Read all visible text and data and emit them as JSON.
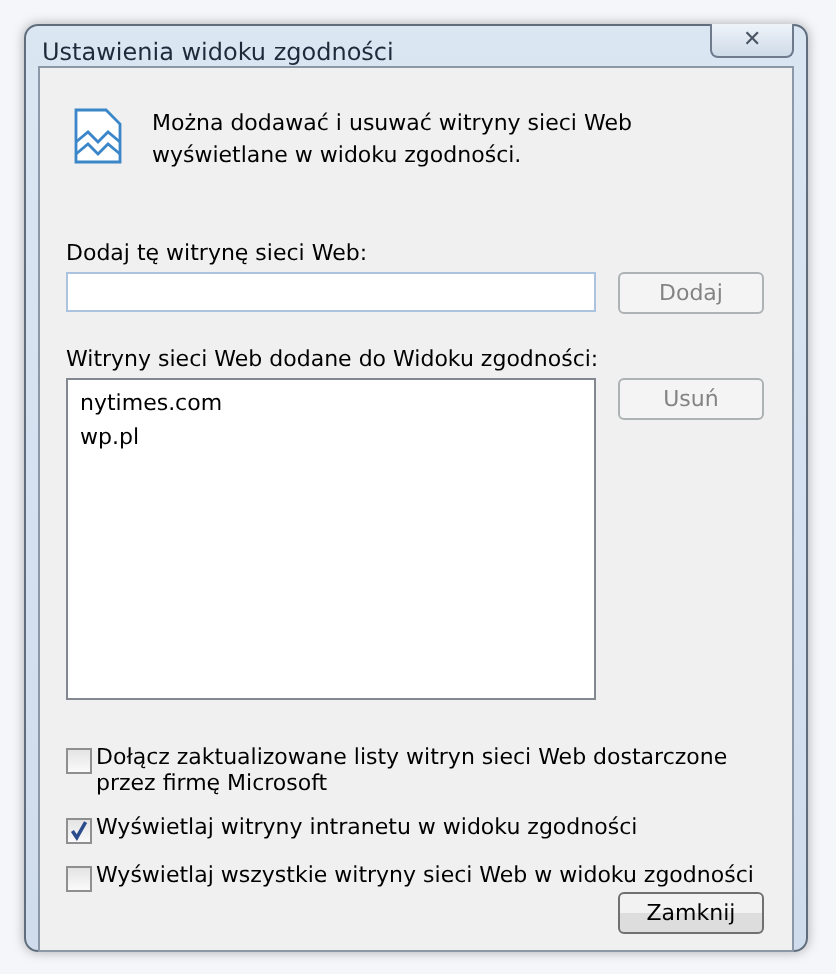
{
  "window": {
    "title": "Ustawienia widoku zgodności",
    "close": "✕"
  },
  "intro": "Można dodawać i usuwać witryny sieci Web wyświetlane w widoku zgodności.",
  "add_site": {
    "label": "Dodaj tę witrynę sieci Web:",
    "button": {
      "label": "Dodaj",
      "disabled": true
    }
  },
  "sites": {
    "label": "Witryny sieci Web dodane do Widoku zgodności:",
    "items": [
      {
        "text": "nytimes.com",
        "selected": false
      },
      {
        "text": "wp.pl",
        "selected": false
      }
    ],
    "button": {
      "label": "Usuń",
      "disabled": true
    }
  },
  "options": [
    {
      "label": "Dołącz zaktualizowane listy witryn sieci Web dostarczone przez firmę Microsoft",
      "checked": false
    },
    {
      "label": "Wyświetlaj witryny intranetu w widoku zgodności",
      "checked": true
    },
    {
      "label": "Wyświetlaj wszystkie witryny sieci Web w widoku zgodności",
      "checked": false
    }
  ],
  "close_button": {
    "label": "Zamknij",
    "disabled": false
  }
}
